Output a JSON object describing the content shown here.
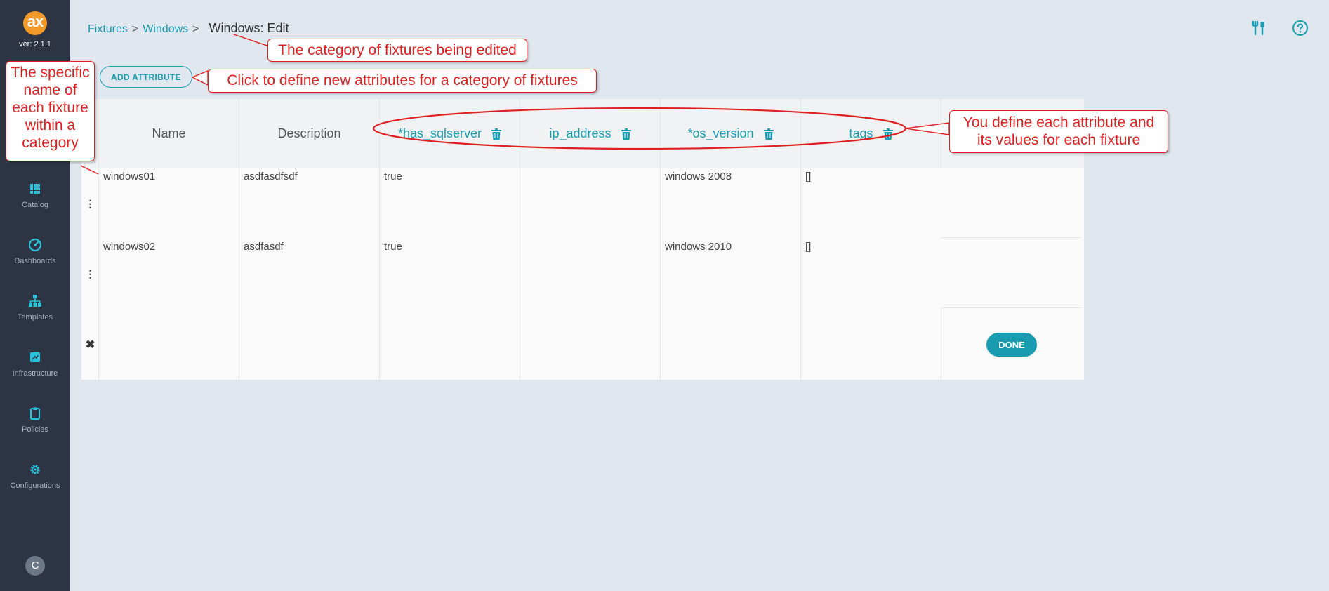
{
  "sidebar": {
    "logo_text": "ax",
    "version": "ver: 2.1.1",
    "items": [
      {
        "label": "Catalog",
        "icon": "grid-icon"
      },
      {
        "label": "Dashboards",
        "icon": "gauge-icon"
      },
      {
        "label": "Templates",
        "icon": "hierarchy-icon"
      },
      {
        "label": "Infrastructure",
        "icon": "infrastructure-icon"
      },
      {
        "label": "Policies",
        "icon": "clipboard-icon"
      },
      {
        "label": "Configurations",
        "icon": "gear-icon"
      }
    ],
    "avatar_initial": "C"
  },
  "breadcrumb": {
    "fixtures": "Fixtures",
    "windows": "Windows",
    "separator": ">",
    "current": "Windows: Edit"
  },
  "toolbar": {
    "add_attribute_label": "ADD ATTRIBUTE",
    "done_label": "DONE"
  },
  "table": {
    "headers": {
      "name": "Name",
      "description": "Description",
      "has_sqlserver": "*has_sqlserver",
      "ip_address": "ip_address",
      "os_version": "*os_version",
      "tags": "tags"
    },
    "rows": [
      {
        "name": "windows01",
        "description": "asdfasdfsdf",
        "has_sqlserver": "true",
        "ip_address": "",
        "os_version": "windows 2008",
        "tags": "[]"
      },
      {
        "name": "windows02",
        "description": "asdfasdf",
        "has_sqlserver": "true",
        "ip_address": "",
        "os_version": "windows 2010",
        "tags": "[]"
      }
    ]
  },
  "callouts": {
    "category": "The category of fixtures being edited",
    "add_attribute": "Click to define new attributes for a category of fixtures",
    "fixture_name": "The specific name of each fixture within a category",
    "attributes": "You define each attribute and its values for each fixture"
  },
  "colors": {
    "accent": "#1a9cb0",
    "sidebar": "#2d3545",
    "logo": "#f39a2a",
    "annotation": "#e02020"
  }
}
